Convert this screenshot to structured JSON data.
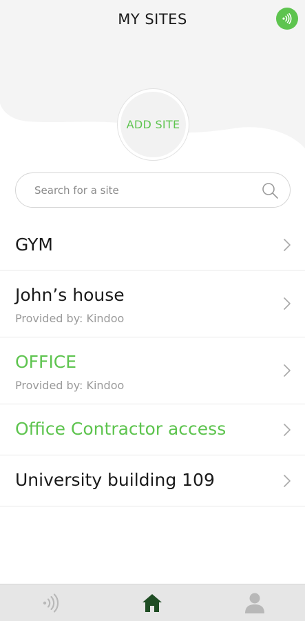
{
  "header": {
    "title": "MY SITES",
    "nfc_icon": "nfc-signal-icon"
  },
  "add_site": {
    "label": "ADD SITE"
  },
  "search": {
    "placeholder": "Search for a site",
    "icon": "search-icon"
  },
  "sites": [
    {
      "name": "GYM",
      "provider": "",
      "highlighted": false
    },
    {
      "name": "John’s house",
      "provider": "Provided by: Kindoo",
      "highlighted": false
    },
    {
      "name": "OFFICE",
      "provider": "Provided by: Kindoo",
      "highlighted": true
    },
    {
      "name": "Office Contractor access",
      "provider": "",
      "highlighted": true
    },
    {
      "name": "University building 109",
      "provider": "",
      "highlighted": false
    }
  ],
  "bottom_nav": {
    "items": [
      {
        "icon": "nfc-signal-icon",
        "active": false
      },
      {
        "icon": "home-icon",
        "active": true
      },
      {
        "icon": "user-icon",
        "active": false
      }
    ]
  },
  "colors": {
    "accent": "#5ec44f",
    "text": "#1a1a1a",
    "muted": "#9a9a9a",
    "nav_active": "#1f4d24",
    "nav_inactive": "#b8b8b8"
  }
}
